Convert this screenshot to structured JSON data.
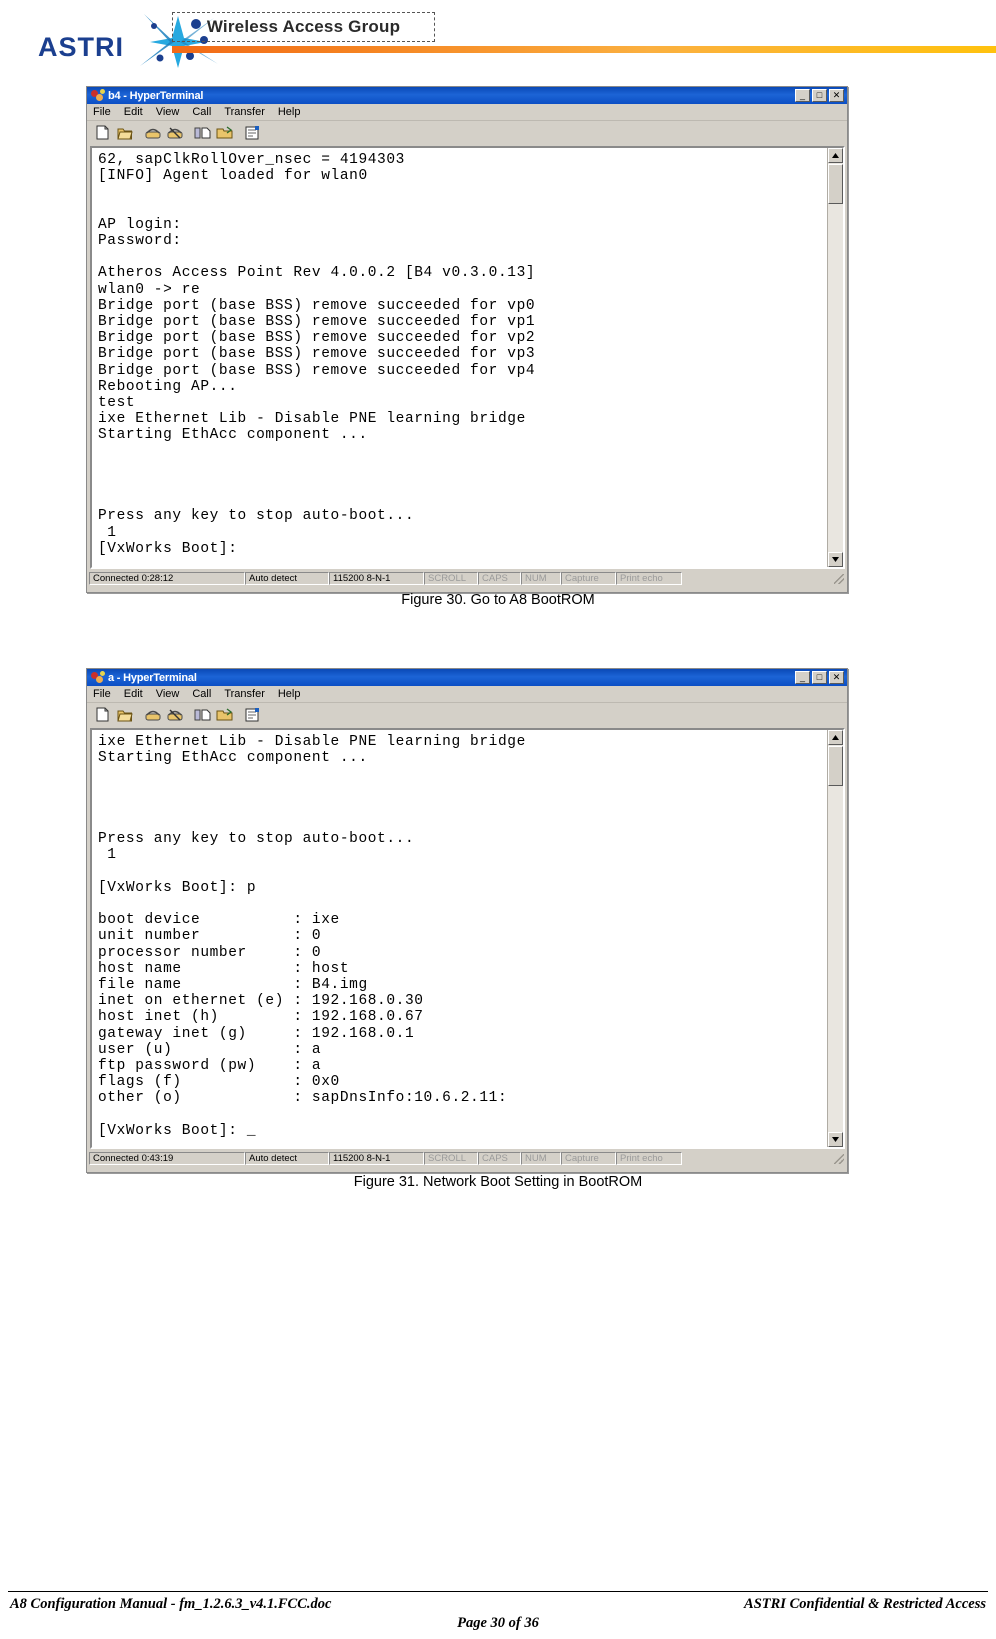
{
  "banner": {
    "logo_text": "ASTRI",
    "logo_icon": "starburst-people-icon",
    "group_title": "Wireless Access Group"
  },
  "figures": [
    {
      "caption": "Figure 30. Go to A8 BootROM",
      "window": {
        "title": "b4 - HyperTerminal",
        "title_icon": "hyperterminal-icon",
        "window_buttons": [
          {
            "name": "minimize",
            "glyph": "_"
          },
          {
            "name": "maximize",
            "glyph": "□"
          },
          {
            "name": "close",
            "glyph": "✕"
          }
        ],
        "menu": [
          "File",
          "Edit",
          "View",
          "Call",
          "Transfer",
          "Help"
        ],
        "toolbar_icons": [
          "new-connection-icon",
          "open-icon",
          "call-icon",
          "disconnect-icon",
          "send-file-icon",
          "receive-file-icon",
          "properties-icon"
        ],
        "terminal_lines": [
          "62, sapClkRollOver_nsec = 4194303",
          "[INFO] Agent loaded for wlan0",
          "",
          "",
          "AP login:",
          "Password:",
          "",
          "Atheros Access Point Rev 4.0.0.2 [B4 v0.3.0.13]",
          "wlan0 -> re",
          "Bridge port (base BSS) remove succeeded for vp0",
          "Bridge port (base BSS) remove succeeded for vp1",
          "Bridge port (base BSS) remove succeeded for vp2",
          "Bridge port (base BSS) remove succeeded for vp3",
          "Bridge port (base BSS) remove succeeded for vp4",
          "Rebooting AP...",
          "test",
          "ixe Ethernet Lib - Disable PNE learning bridge",
          "Starting EthAcc component ...",
          "",
          "",
          "",
          "",
          "Press any key to stop auto-boot...",
          " 1",
          "[VxWorks Boot]:"
        ],
        "status": {
          "connected": "Connected 0:28:12",
          "detect": "Auto detect",
          "line": "115200 8-N-1",
          "scroll": "SCROLL",
          "caps": "CAPS",
          "num": "NUM",
          "capture": "Capture",
          "print_echo": "Print echo"
        }
      }
    },
    {
      "caption": "Figure 31. Network Boot Setting in BootROM",
      "window": {
        "title": "a - HyperTerminal",
        "title_icon": "hyperterminal-icon",
        "window_buttons": [
          {
            "name": "minimize",
            "glyph": "_"
          },
          {
            "name": "maximize",
            "glyph": "□"
          },
          {
            "name": "close",
            "glyph": "✕"
          }
        ],
        "menu": [
          "File",
          "Edit",
          "View",
          "Call",
          "Transfer",
          "Help"
        ],
        "toolbar_icons": [
          "new-connection-icon",
          "open-icon",
          "call-icon",
          "disconnect-icon",
          "send-file-icon",
          "receive-file-icon",
          "properties-icon"
        ],
        "terminal_lines": [
          "ixe Ethernet Lib - Disable PNE learning bridge",
          "Starting EthAcc component ...",
          "",
          "",
          "",
          "",
          "Press any key to stop auto-boot...",
          " 1",
          "",
          "[VxWorks Boot]: p",
          "",
          "boot device          : ixe",
          "unit number          : 0",
          "processor number     : 0",
          "host name            : host",
          "file name            : B4.img",
          "inet on ethernet (e) : 192.168.0.30",
          "host inet (h)        : 192.168.0.67",
          "gateway inet (g)     : 192.168.0.1",
          "user (u)             : a",
          "ftp password (pw)    : a",
          "flags (f)            : 0x0",
          "other (o)            : sapDnsInfo:10.6.2.11:",
          "",
          "[VxWorks Boot]: _"
        ],
        "status": {
          "connected": "Connected 0:43:19",
          "detect": "Auto detect",
          "line": "115200 8-N-1",
          "scroll": "SCROLL",
          "caps": "CAPS",
          "num": "NUM",
          "capture": "Capture",
          "print_echo": "Print echo"
        }
      }
    }
  ],
  "footer": {
    "left": "A8 Configuration Manual - fm_1.2.6.3_v4.1.FCC.doc",
    "right": "ASTRI Confidential & Restricted Access",
    "center": "Page 30 of 36"
  },
  "colors": {
    "titlebar_blue": "#0b4ec4",
    "chrome_gray": "#d4d0c8",
    "accent_orange": "#f58220",
    "logo_blue": "#1b3f8f",
    "terminal_bg": "#ffffff",
    "terminal_fg": "#000000"
  }
}
